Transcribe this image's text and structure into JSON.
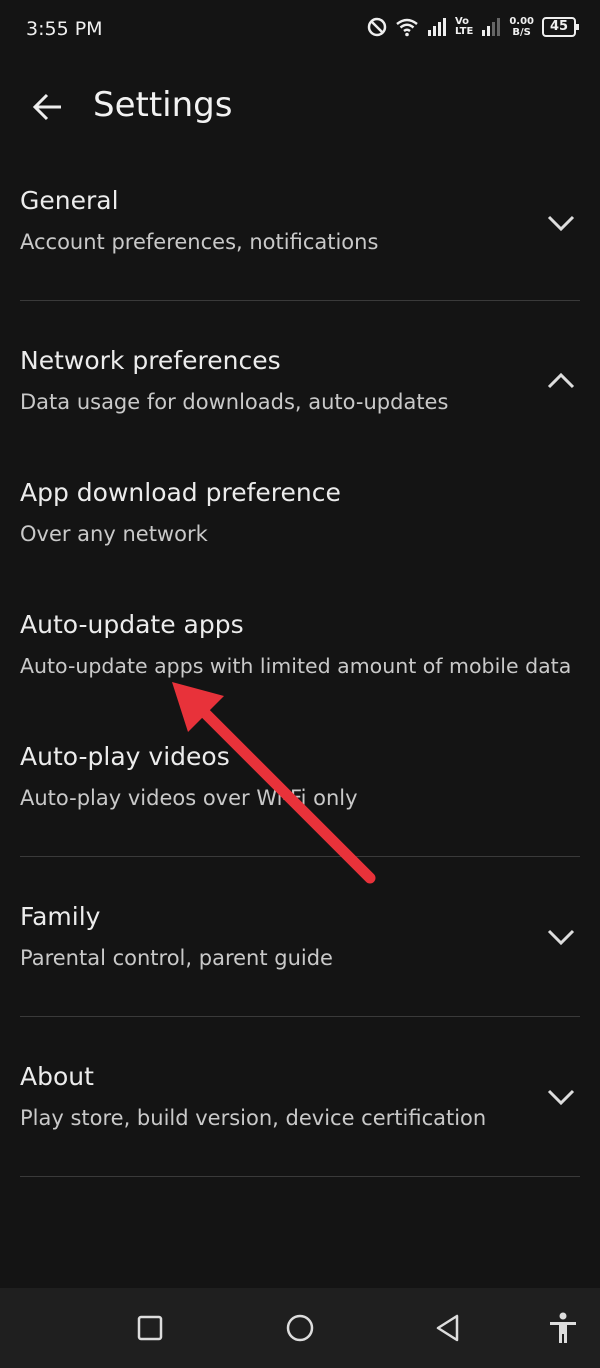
{
  "status_bar": {
    "time": "3:55 PM",
    "lte": "Vo\nLTE",
    "speed_value": "0.00",
    "speed_unit": "B/S",
    "battery": "45"
  },
  "header": {
    "title": "Settings"
  },
  "sections": {
    "general": {
      "title": "General",
      "subtitle": "Account preferences, notifications"
    },
    "network": {
      "title": "Network preferences",
      "subtitle": "Data usage for downloads, auto-updates"
    },
    "family": {
      "title": "Family",
      "subtitle": "Parental control, parent guide"
    },
    "about": {
      "title": "About",
      "subtitle": "Play store, build version, device certification"
    }
  },
  "network_items": {
    "app_download": {
      "title": "App download preference",
      "subtitle": "Over any network"
    },
    "auto_update": {
      "title": "Auto-update apps",
      "subtitle": "Auto-update apps with limited amount of mobile data"
    },
    "auto_play": {
      "title": "Auto-play videos",
      "subtitle": "Auto-play videos over Wi-Fi only"
    }
  },
  "icons": {
    "back": "arrow-left-icon",
    "expand": "chevron-down-icon",
    "collapse": "chevron-up-icon",
    "nav_recents": "square-icon",
    "nav_home": "circle-icon",
    "nav_back": "triangle-back-icon",
    "accessibility": "accessibility-icon"
  },
  "colors": {
    "background": "#141414",
    "annotation_arrow": "#e8323a",
    "nav_bar": "#1f1f1f"
  }
}
